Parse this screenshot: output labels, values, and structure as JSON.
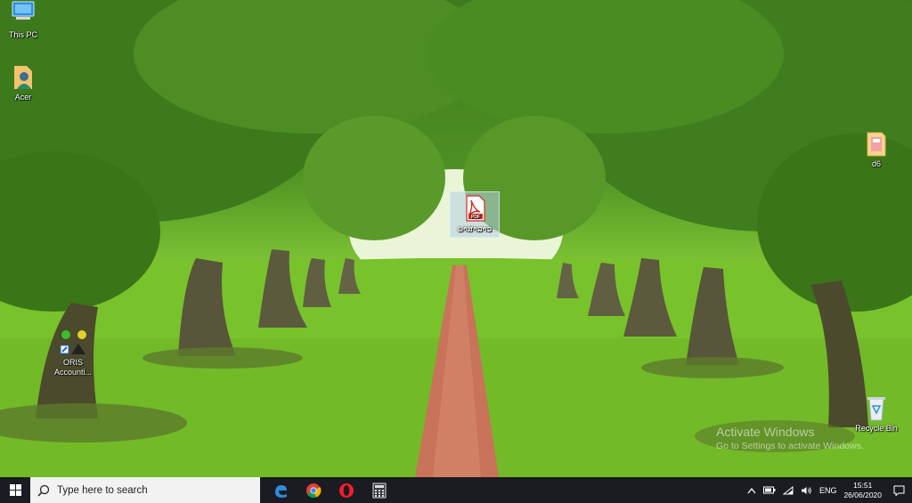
{
  "desktop": {
    "icons": [
      {
        "label": "This PC",
        "icon": "computer-icon"
      },
      {
        "label": "Acer",
        "icon": "user-folder-icon"
      },
      {
        "label": "ພາສາລາວ",
        "icon": "pdf-file-icon"
      },
      {
        "label": "d6",
        "icon": "folder-icon"
      },
      {
        "label": "ORIS Accounti...",
        "icon": "app-shortcut-icon"
      },
      {
        "label": "Recycle Bin",
        "icon": "recycle-bin-icon"
      }
    ],
    "watermark": {
      "line1": "Activate Windows",
      "line2": "Go to Settings to activate Windows."
    }
  },
  "taskbar": {
    "search_placeholder": "Type here to search",
    "apps": [
      "edge-icon",
      "chrome-icon",
      "opera-icon",
      "calculator-icon"
    ],
    "tray": {
      "language": "ENG",
      "time": "15:51",
      "date": "26/06/2020"
    }
  },
  "colors": {
    "taskbar": "#1b1b22",
    "search_bg": "#f2f2f2",
    "grass": "#7cc233",
    "path": "#c8735a"
  }
}
